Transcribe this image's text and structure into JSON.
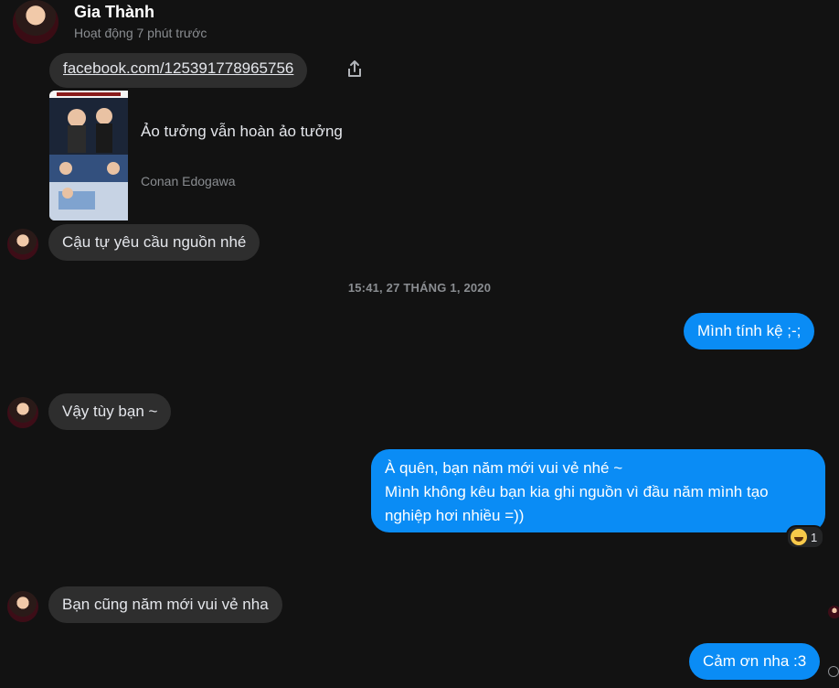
{
  "header": {
    "name": "Gia Thành",
    "status": "Hoạt động 7 phút trước"
  },
  "messages": {
    "link_text": "facebook.com/125391778965756",
    "preview_title": "Ảo tưởng vẫn hoàn ảo tưởng",
    "preview_source": "Conan Edogawa",
    "msg1": "Cậu tự yêu cầu nguồn nhé",
    "timestamp": "15:41, 27 THÁNG 1, 2020",
    "msg2": "Mình tính kệ ;-;",
    "msg3": "Vậy tùy bạn ~",
    "msg4_line1": "À quên, bạn năm mới vui vẻ nhé ~",
    "msg4_line2": "Mình không kêu bạn kia ghi nguồn vì đầu năm mình tạo",
    "msg4_line3": "nghiệp hơi nhiều =))",
    "msg4_reaction_count": "1",
    "msg5": "Bạn cũng năm mới vui vẻ nha",
    "msg6": "Cảm ơn nha :3"
  },
  "colors": {
    "background": "#121212",
    "incoming_bubble": "#2e2e2e",
    "outgoing_bubble": "#0a8cf5"
  },
  "icons": {
    "share": "share-icon",
    "reaction": "grinning-emoji-icon"
  }
}
